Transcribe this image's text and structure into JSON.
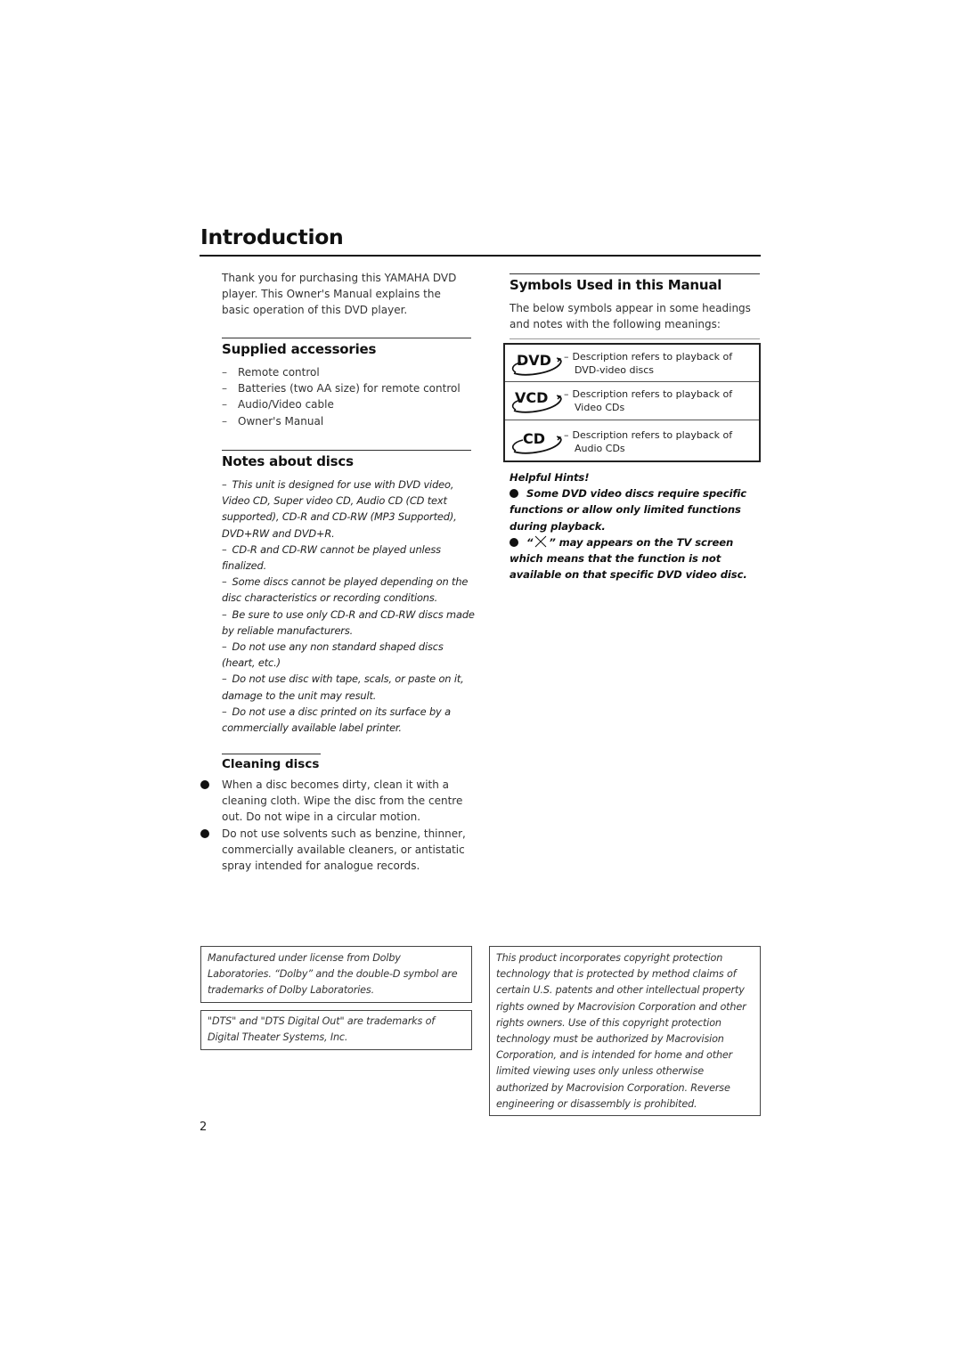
{
  "page": {
    "title": "Introduction",
    "intro": "Thank you for purchasing this YAMAHA DVD player. This Owner's Manual explains the basic operation of this DVD player.",
    "page_number": "2"
  },
  "accessories": {
    "title": "Supplied accessories",
    "items": [
      "Remote control",
      "Batteries (two AA size) for remote control",
      "Audio/Video cable",
      "Owner's Manual"
    ]
  },
  "notes": {
    "title": "Notes about discs",
    "dash": "–",
    "items": [
      "This unit is designed for use with DVD video, Video CD, Super video CD, Audio CD (CD text supported), CD-R and CD-RW (MP3 Supported), DVD+RW and DVD+R.",
      "CD-R and CD-RW cannot be played unless finalized.",
      "Some discs cannot be played depending on the disc characteristics or recording conditions.",
      "Be sure to use only CD-R and CD-RW discs made by reliable manufacturers.",
      "Do not use any non standard shaped discs (heart, etc.)",
      "Do not use disc with tape, scals, or paste on it, damage to the unit may result.",
      "Do not use a disc printed on its surface by a commercially available label printer."
    ]
  },
  "cleaning": {
    "title": "Cleaning discs",
    "items": [
      "When a disc becomes dirty, clean it with a cleaning cloth. Wipe the disc from the centre out. Do not wipe in a circular motion.",
      "Do not use solvents such as benzine, thinner, commercially available cleaners, or antistatic spray intended for analogue records."
    ]
  },
  "symbols": {
    "title": "Symbols Used in this Manual",
    "description": "The below symbols appear in some headings and notes with the following meanings:",
    "rows": [
      {
        "logo": "DVD",
        "icon": "dvd-logo-icon",
        "line1": "Description refers to playback of",
        "line2": "DVD-video discs"
      },
      {
        "logo": "VCD",
        "icon": "vcd-logo-icon",
        "line1": "Description refers to playback of",
        "line2": "Video CDs"
      },
      {
        "logo": "CD",
        "icon": "cd-logo-icon",
        "line1": "Description refers to playback of",
        "line2": "Audio CDs"
      }
    ]
  },
  "hints": {
    "title": "Helpful Hints!",
    "item1": "Some DVD video discs require specific functions or allow only limited functions during playback.",
    "item2_open": "“",
    "item2_close": "” may appears on the TV screen which means that the function is not available on that specific DVD video disc."
  },
  "legal": {
    "dolby": "Manufactured under license from Dolby Laboratories. “Dolby” and the double-D symbol are trademarks of Dolby Laboratories.",
    "dts": "\"DTS\" and \"DTS Digital Out\" are trademarks of Digital Theater Systems, Inc.",
    "macrovision": "This product incorporates copyright protection technology that is protected by method claims of certain U.S. patents and other intellectual property rights owned by Macrovision Corporation and other rights owners. Use of this copyright protection technology must be authorized by Macrovision Corporation, and is intended for home and other limited viewing uses only unless otherwise authorized by Macrovision Corporation. Reverse engineering or disassembly is prohibited."
  }
}
